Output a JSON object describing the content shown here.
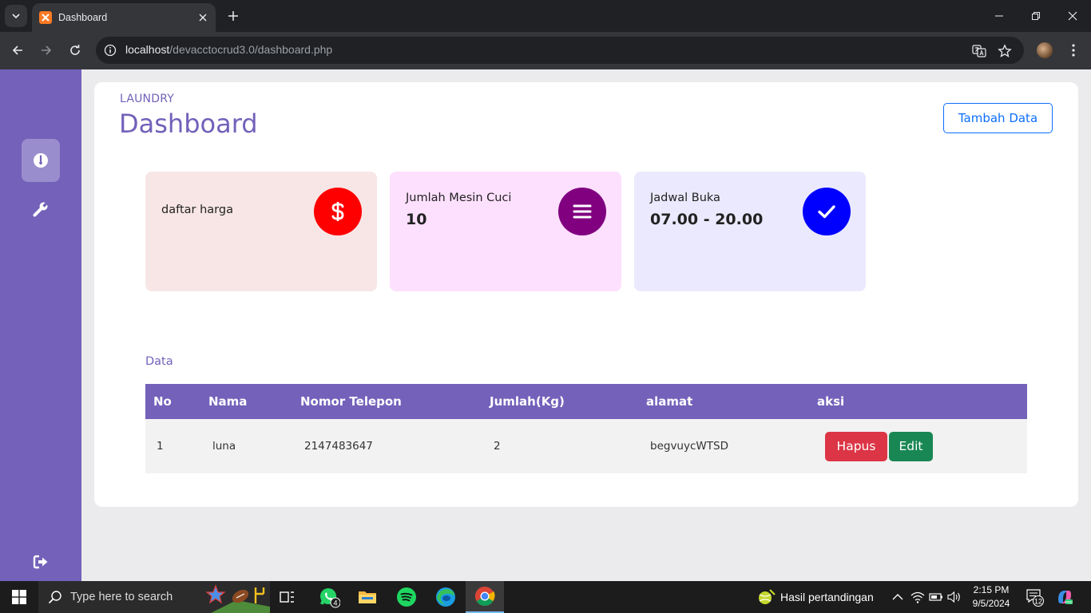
{
  "browser": {
    "tab_title": "Dashboard",
    "url_host": "localhost",
    "url_path": "/devacctocrud3.0/dashboard.php"
  },
  "page": {
    "breadcrumb": "LAUNDRY",
    "title": "Dashboard",
    "add_button": "Tambah Data"
  },
  "cards": [
    {
      "label": "daftar harga",
      "value": "",
      "icon": "dollar-icon",
      "bg": "#f8e6e6",
      "icon_bg": "#ff0000"
    },
    {
      "label": "Jumlah Mesin Cuci",
      "value": "10",
      "icon": "menu-lines-icon",
      "bg": "#fde0fd",
      "icon_bg": "#800080"
    },
    {
      "label": "Jadwal Buka",
      "value": "07.00 - 20.00",
      "icon": "check-icon",
      "bg": "#ebe9fd",
      "icon_bg": "#0000ff"
    }
  ],
  "table": {
    "section_label": "Data",
    "headers": [
      "No",
      "Nama",
      "Nomor Telepon",
      "Jumlah(Kg)",
      "alamat",
      "aksi"
    ],
    "rows": [
      {
        "no": "1",
        "nama": "luna",
        "telepon": "2147483647",
        "jumlah": "2",
        "alamat": "begvuycWTSD"
      }
    ],
    "delete_label": "Hapus",
    "edit_label": "Edit"
  },
  "colors": {
    "accent": "#7361ba",
    "danger": "#dc3545",
    "success": "#198754",
    "primary": "#0d6efd"
  },
  "taskbar": {
    "search_placeholder": "Type here to search",
    "whatsapp_badge": "4",
    "news_text": "Hasil pertandingan",
    "time": "2:15 PM",
    "date": "9/5/2024",
    "notification_count": "12"
  }
}
